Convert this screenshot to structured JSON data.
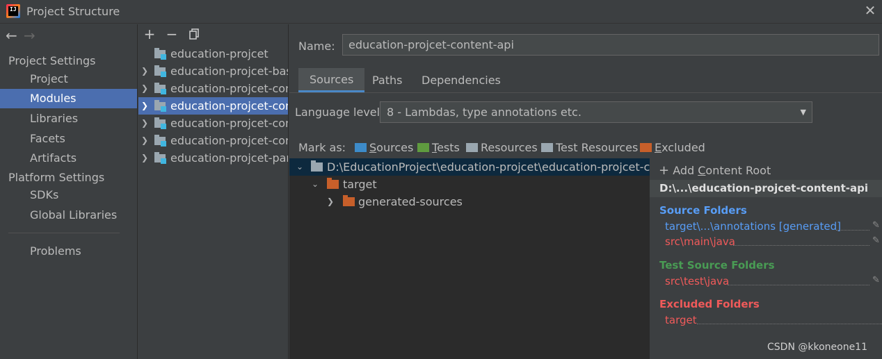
{
  "window": {
    "title": "Project Structure",
    "app_icon_text": "IJ"
  },
  "sidebar": {
    "project_settings_label": "Project Settings",
    "platform_settings_label": "Platform Settings",
    "items": [
      {
        "label": "Project"
      },
      {
        "label": "Modules"
      },
      {
        "label": "Libraries"
      },
      {
        "label": "Facets"
      },
      {
        "label": "Artifacts"
      },
      {
        "label": "SDKs"
      },
      {
        "label": "Global Libraries"
      },
      {
        "label": "Problems"
      }
    ],
    "selected": "Modules"
  },
  "module_list": {
    "toolbar": {
      "add": "+",
      "remove": "−",
      "copy": "copy"
    },
    "modules": [
      {
        "name": "education-projcet",
        "expandable": false
      },
      {
        "name": "education-projcet-base",
        "expandable": true
      },
      {
        "name": "education-projcet-cont",
        "expandable": true
      },
      {
        "name": "education-projcet-cont",
        "expandable": true,
        "selected": true
      },
      {
        "name": "education-projcet-cont",
        "expandable": true
      },
      {
        "name": "education-projcet-cont",
        "expandable": true
      },
      {
        "name": "education-projcet-pare",
        "expandable": true
      }
    ]
  },
  "details": {
    "name_label": "Name:",
    "name_value": "education-projcet-content-api",
    "tabs": [
      {
        "label": "Sources",
        "active": true
      },
      {
        "label": "Paths"
      },
      {
        "label": "Dependencies"
      }
    ],
    "language_level_label": "Language level:",
    "language_level_value": "8 - Lambdas, type annotations etc.",
    "mark_as_label": "Mark as:",
    "mark_as": [
      {
        "label": "Sources",
        "accel": "S",
        "rest": "ources",
        "color": "#3d8bc9"
      },
      {
        "label": "Tests",
        "accel": "T",
        "rest": "ests",
        "color": "#5f9b3f"
      },
      {
        "label": "Resources",
        "accel": "",
        "rest": "Resources",
        "color": "#9aa7b0"
      },
      {
        "label": "Test Resources",
        "accel": "",
        "rest": "Test Resources",
        "color": "#9aa7b0"
      },
      {
        "label": "Excluded",
        "accel": "E",
        "rest": "xcluded",
        "color": "#c75f2a"
      }
    ]
  },
  "tree": {
    "rows": [
      {
        "label": "D:\\EducationProject\\education-projcet\\education-projcet-content-api",
        "color": "#9aa7b0",
        "chevron": "down"
      },
      {
        "label": "target",
        "color": "#c75f2a",
        "chevron": "down"
      },
      {
        "label": "generated-sources",
        "color": "#c75f2a",
        "chevron": "right"
      }
    ]
  },
  "content_roots": {
    "add_label": "Add Content Root",
    "add_accel": "C",
    "root_path": "D:\\...\\education-projcet-content-api",
    "source_folders_title": "Source Folders",
    "source_color": "#589df6",
    "source_folders": [
      {
        "path": "target\\...\\annotations [generated]",
        "color": "#589df6"
      },
      {
        "path": "src\\main\\java",
        "color": "#f05a5a"
      }
    ],
    "test_folders_title": "Test Source Folders",
    "test_color": "#499c54",
    "test_folders": [
      {
        "path": "src\\test\\java",
        "color": "#f05a5a"
      }
    ],
    "excluded_title": "Excluded Folders",
    "excluded_color": "#f05a5a",
    "excluded_folders": [
      {
        "path": "target",
        "color": "#f05a5a"
      }
    ]
  },
  "watermark": "CSDN @kkoneone11"
}
